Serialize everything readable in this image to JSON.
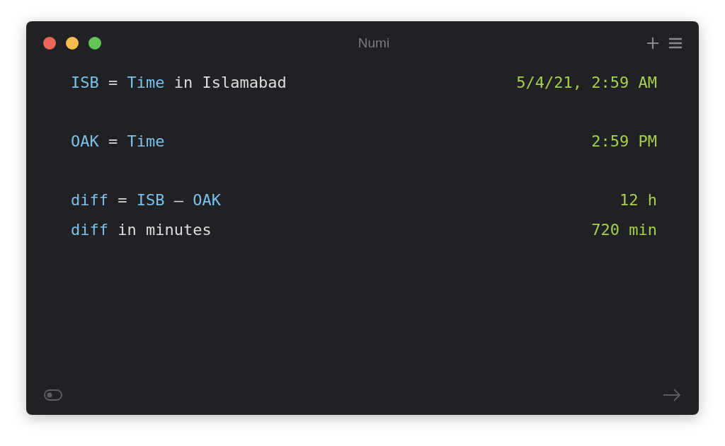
{
  "window": {
    "title": "Numi"
  },
  "lines": [
    {
      "kind": "expr",
      "tokens": [
        {
          "kind": "var",
          "text": "ISB"
        },
        {
          "kind": "op",
          "text": "="
        },
        {
          "kind": "var",
          "text": "Time"
        },
        {
          "kind": "word",
          "text": "in Islamabad"
        }
      ],
      "result": "5/4/21, 2:59 AM"
    },
    {
      "kind": "blank"
    },
    {
      "kind": "expr",
      "tokens": [
        {
          "kind": "var",
          "text": "OAK"
        },
        {
          "kind": "op",
          "text": "="
        },
        {
          "kind": "var",
          "text": "Time"
        }
      ],
      "result": "2:59 PM"
    },
    {
      "kind": "blank"
    },
    {
      "kind": "expr",
      "tokens": [
        {
          "kind": "var",
          "text": "diff"
        },
        {
          "kind": "op",
          "text": "="
        },
        {
          "kind": "var",
          "text": "ISB"
        },
        {
          "kind": "op",
          "text": "–"
        },
        {
          "kind": "var",
          "text": "OAK"
        }
      ],
      "result": "12 h"
    },
    {
      "kind": "expr",
      "tokens": [
        {
          "kind": "var",
          "text": "diff"
        },
        {
          "kind": "word",
          "text": "in minutes"
        }
      ],
      "result": "720 min"
    }
  ]
}
